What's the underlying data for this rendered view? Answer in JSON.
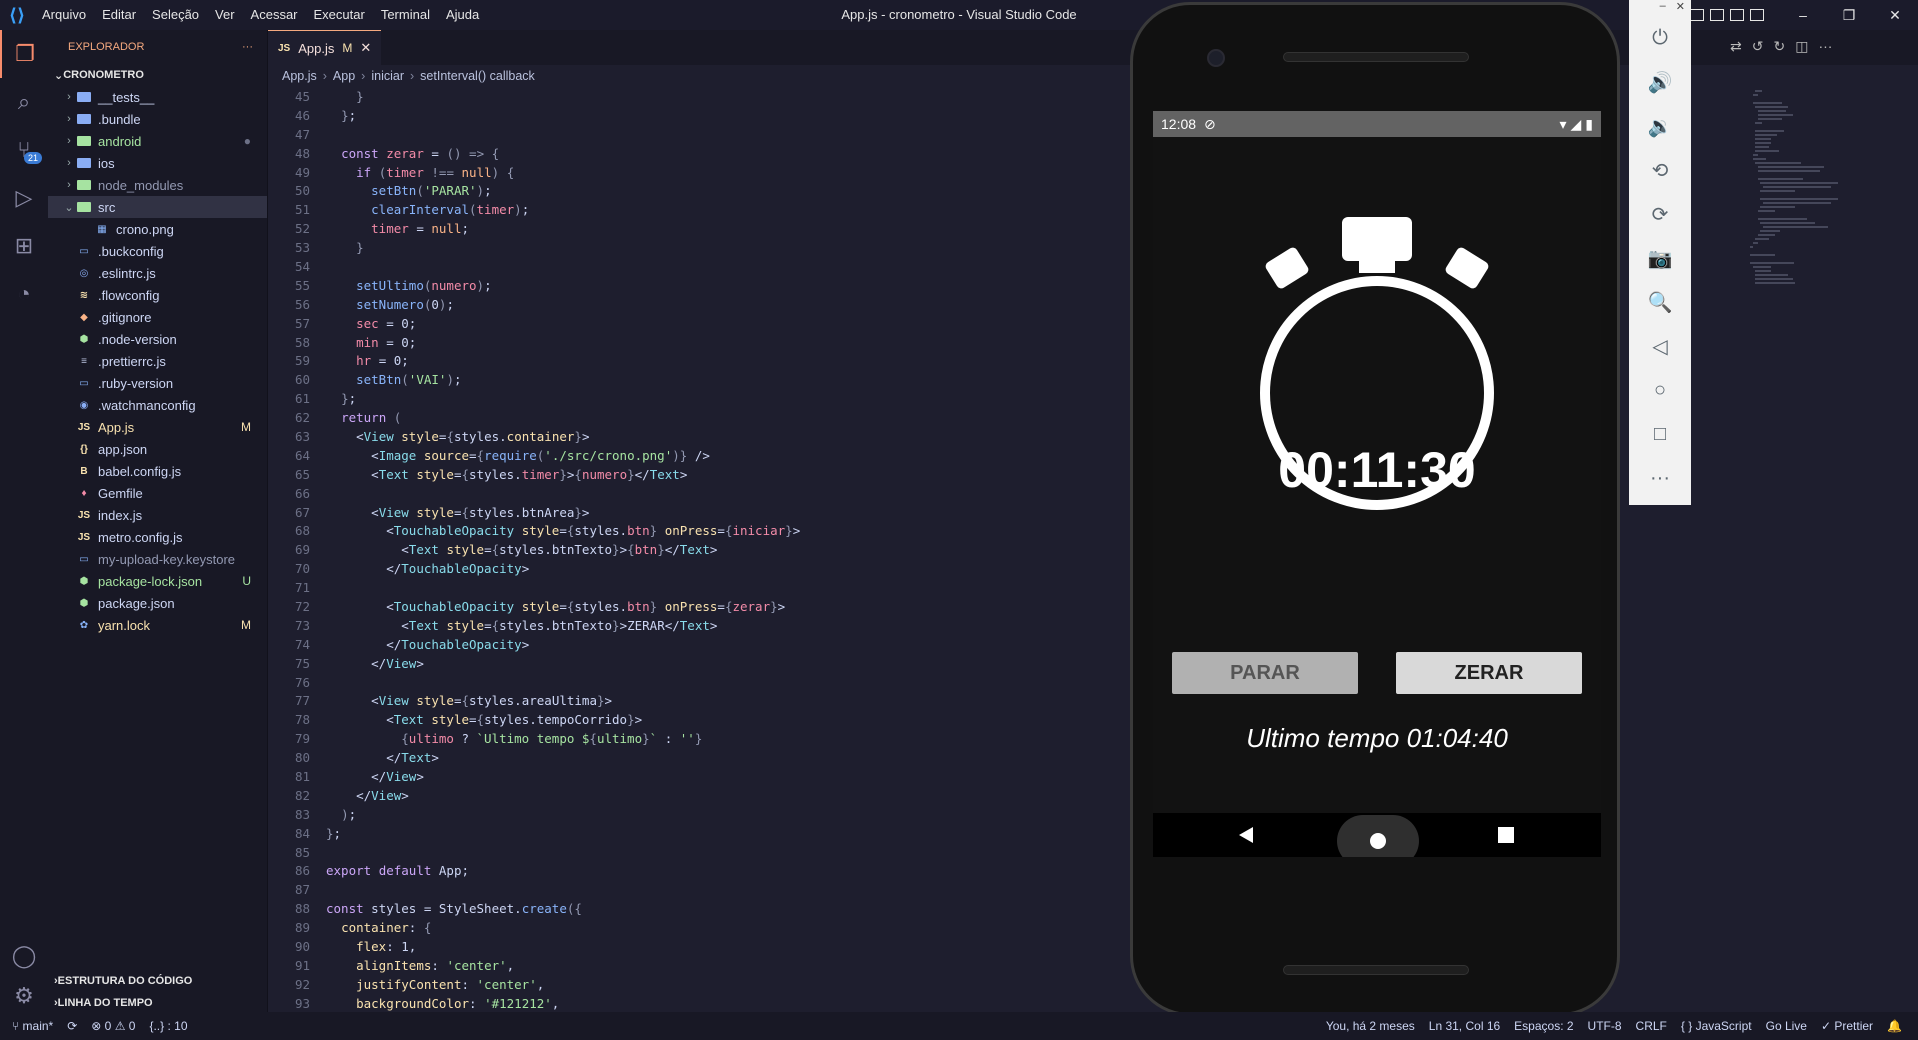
{
  "window": {
    "title": "App.js - cronometro - Visual Studio Code",
    "menu": [
      "Arquivo",
      "Editar",
      "Seleção",
      "Ver",
      "Acessar",
      "Executar",
      "Terminal",
      "Ajuda"
    ],
    "controls": [
      "–",
      "❐",
      "✕"
    ]
  },
  "activity": {
    "scm_badge": "21"
  },
  "explorer": {
    "header": "EXPLORADOR",
    "more": "···",
    "project": "CRONOMETRO",
    "items": [
      {
        "name": "__tests__",
        "type": "folder",
        "indent": 1
      },
      {
        "name": ".bundle",
        "type": "folder",
        "indent": 1
      },
      {
        "name": "android",
        "type": "folder",
        "indent": 1,
        "color": "#a6e3a1",
        "flag": "●"
      },
      {
        "name": "ios",
        "type": "folder",
        "indent": 1
      },
      {
        "name": "node_modules",
        "type": "folder",
        "indent": 1,
        "color": "#9399b2"
      },
      {
        "name": "src",
        "type": "folder-open",
        "indent": 1
      },
      {
        "name": "crono.png",
        "type": "file",
        "indent": 2,
        "icon": "img"
      },
      {
        "name": ".buckconfig",
        "type": "file",
        "indent": 1,
        "icon": "doc"
      },
      {
        "name": ".eslintrc.js",
        "type": "file",
        "indent": 1,
        "icon": "eslint"
      },
      {
        "name": ".flowconfig",
        "type": "file",
        "indent": 1,
        "icon": "flow"
      },
      {
        "name": ".gitignore",
        "type": "file",
        "indent": 1,
        "icon": "git"
      },
      {
        "name": ".node-version",
        "type": "file",
        "indent": 1,
        "icon": "node"
      },
      {
        "name": ".prettierrc.js",
        "type": "file",
        "indent": 1,
        "icon": "prettier"
      },
      {
        "name": ".ruby-version",
        "type": "file",
        "indent": 1,
        "icon": "doc"
      },
      {
        "name": ".watchmanconfig",
        "type": "file",
        "indent": 1,
        "icon": "watch"
      },
      {
        "name": "App.js",
        "type": "file",
        "indent": 1,
        "icon": "js",
        "color": "#f9e2af",
        "flag": "M"
      },
      {
        "name": "app.json",
        "type": "file",
        "indent": 1,
        "icon": "json"
      },
      {
        "name": "babel.config.js",
        "type": "file",
        "indent": 1,
        "icon": "babel"
      },
      {
        "name": "Gemfile",
        "type": "file",
        "indent": 1,
        "icon": "gem"
      },
      {
        "name": "index.js",
        "type": "file",
        "indent": 1,
        "icon": "js"
      },
      {
        "name": "metro.config.js",
        "type": "file",
        "indent": 1,
        "icon": "js"
      },
      {
        "name": "my-upload-key.keystore",
        "type": "file",
        "indent": 1,
        "icon": "doc",
        "color": "#9399b2"
      },
      {
        "name": "package-lock.json",
        "type": "file",
        "indent": 1,
        "icon": "node",
        "color": "#a6e3a1",
        "flag": "U"
      },
      {
        "name": "package.json",
        "type": "file",
        "indent": 1,
        "icon": "node"
      },
      {
        "name": "yarn.lock",
        "type": "file",
        "indent": 1,
        "icon": "yarn",
        "color": "#f9e2af",
        "flag": "M"
      }
    ],
    "outline": "ESTRUTURA DO CÓDIGO",
    "timeline": "LINHA DO TEMPO"
  },
  "tab": {
    "label": "App.js",
    "modified": "M",
    "close": "✕"
  },
  "breadcrumb": [
    "App.js",
    "App",
    "iniciar",
    "setInterval() callback"
  ],
  "code_lines": [
    {
      "n": "45",
      "t": "    }"
    },
    {
      "n": "46",
      "t": "  };"
    },
    {
      "n": "47",
      "t": ""
    },
    {
      "n": "48",
      "t": "  const zerar = () => {"
    },
    {
      "n": "49",
      "t": "    if (timer !== null) {"
    },
    {
      "n": "50",
      "t": "      setBtn('PARAR');"
    },
    {
      "n": "51",
      "t": "      clearInterval(timer);"
    },
    {
      "n": "52",
      "t": "      timer = null;"
    },
    {
      "n": "53",
      "t": "    }"
    },
    {
      "n": "54",
      "t": ""
    },
    {
      "n": "55",
      "t": "    setUltimo(numero);"
    },
    {
      "n": "56",
      "t": "    setNumero(0);"
    },
    {
      "n": "57",
      "t": "    sec = 0;"
    },
    {
      "n": "58",
      "t": "    min = 0;"
    },
    {
      "n": "59",
      "t": "    hr = 0;"
    },
    {
      "n": "60",
      "t": "    setBtn('VAI');"
    },
    {
      "n": "61",
      "t": "  };"
    },
    {
      "n": "62",
      "t": "  return ("
    },
    {
      "n": "63",
      "t": "    <View style={styles.container}>"
    },
    {
      "n": "64",
      "t": "      <Image source={require('./src/crono.png')} />"
    },
    {
      "n": "65",
      "t": "      <Text style={styles.timer}>{numero}</Text>"
    },
    {
      "n": "66",
      "t": ""
    },
    {
      "n": "67",
      "t": "      <View style={styles.btnArea}>"
    },
    {
      "n": "68",
      "t": "        <TouchableOpacity style={styles.btn} onPress={iniciar}>"
    },
    {
      "n": "69",
      "t": "          <Text style={styles.btnTexto}>{btn}</Text>"
    },
    {
      "n": "70",
      "t": "        </TouchableOpacity>"
    },
    {
      "n": "71",
      "t": ""
    },
    {
      "n": "72",
      "t": "        <TouchableOpacity style={styles.btn} onPress={zerar}>"
    },
    {
      "n": "73",
      "t": "          <Text style={styles.btnTexto}>ZERAR</Text>"
    },
    {
      "n": "74",
      "t": "        </TouchableOpacity>"
    },
    {
      "n": "75",
      "t": "      </View>"
    },
    {
      "n": "76",
      "t": ""
    },
    {
      "n": "77",
      "t": "      <View style={styles.areaUltima}>"
    },
    {
      "n": "78",
      "t": "        <Text style={styles.tempoCorrido}>"
    },
    {
      "n": "79",
      "t": "          {ultimo ? `Ultimo tempo ${ultimo}` : ''}"
    },
    {
      "n": "80",
      "t": "        </Text>"
    },
    {
      "n": "81",
      "t": "      </View>"
    },
    {
      "n": "82",
      "t": "    </View>"
    },
    {
      "n": "83",
      "t": "  );"
    },
    {
      "n": "84",
      "t": "};"
    },
    {
      "n": "85",
      "t": ""
    },
    {
      "n": "86",
      "t": "export default App;"
    },
    {
      "n": "87",
      "t": ""
    },
    {
      "n": "88",
      "t": "const styles = StyleSheet.create({"
    },
    {
      "n": "89",
      "t": "  container: {"
    },
    {
      "n": "90",
      "t": "    flex: 1,"
    },
    {
      "n": "91",
      "t": "    alignItems: 'center',"
    },
    {
      "n": "92",
      "t": "    justifyContent: 'center',"
    },
    {
      "n": "93",
      "t": "    backgroundColor: '#121212',"
    }
  ],
  "device": {
    "time": "12:08",
    "timer": "00:11:30",
    "btn_left": "PARAR",
    "btn_right": "ZERAR",
    "ultimo": "Ultimo tempo 01:04:40"
  },
  "emulator_toolbar": {
    "top": [
      "–",
      "✕"
    ],
    "buttons": [
      "power-icon",
      "volume-up-icon",
      "volume-down-icon",
      "rotate-left-icon",
      "rotate-right-icon",
      "camera-icon",
      "zoom-icon",
      "back-icon",
      "home-icon",
      "overview-icon",
      "more-icon"
    ],
    "glyphs": [
      "⏻",
      "🔊",
      "🔉",
      "⟲",
      "⟳",
      "📷",
      "🔍",
      "◁",
      "○",
      "□",
      "···"
    ]
  },
  "status": {
    "branch": "main*",
    "sync": "⟳",
    "errors": "⊗ 0 ⚠ 0",
    "selection": "{..} : 10",
    "blame": "You, há 2 meses",
    "position": "Ln 31, Col 16",
    "spaces": "Espaços: 2",
    "encoding": "UTF-8",
    "eol": "CRLF",
    "language": "{ } JavaScript",
    "golive": "Go Live",
    "prettier": "✓ Prettier"
  }
}
